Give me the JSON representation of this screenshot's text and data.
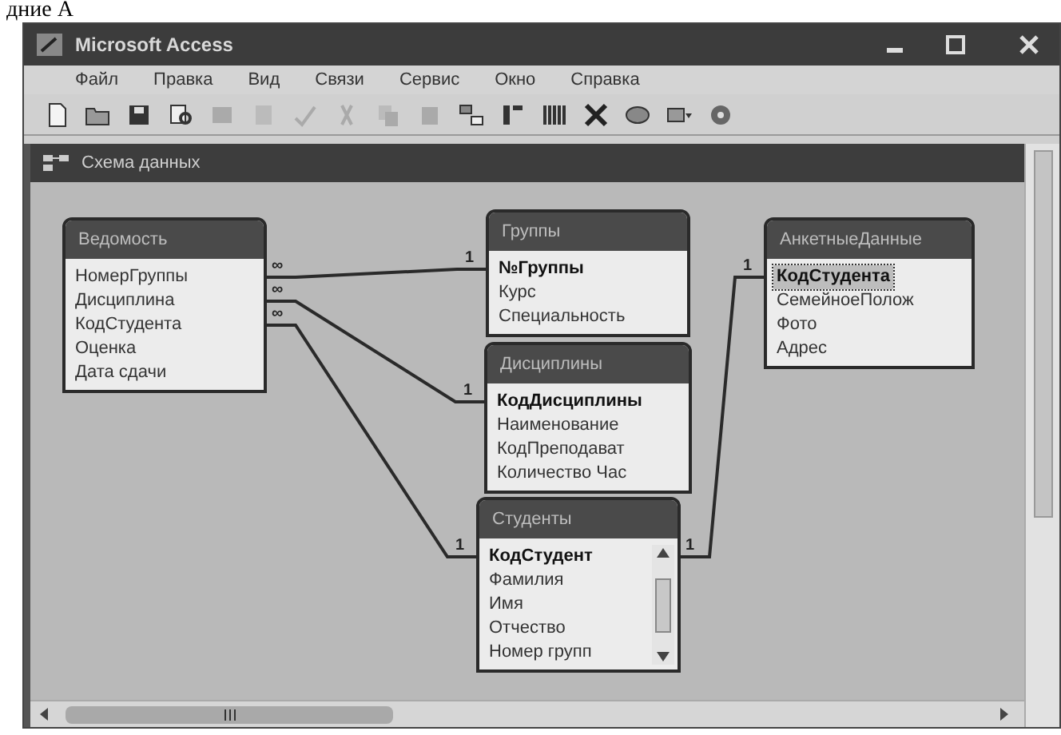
{
  "caption": "дние А",
  "window": {
    "title": "Microsoft Access"
  },
  "menu": [
    "Файл",
    "Правка",
    "Вид",
    "Связи",
    "Сервис",
    "Окно",
    "Справка"
  ],
  "diagram": {
    "title": "Схема данных",
    "tables": [
      {
        "name": "Ведомость",
        "fields": [
          {
            "name": "НомерГруппы",
            "key": false,
            "selected": false
          },
          {
            "name": "Дисциплина",
            "key": false,
            "selected": false
          },
          {
            "name": "КодСтудента",
            "key": false,
            "selected": false
          },
          {
            "name": "Оценка",
            "key": false,
            "selected": false
          },
          {
            "name": "Дата сдачи",
            "key": false,
            "selected": false
          }
        ]
      },
      {
        "name": "Группы",
        "fields": [
          {
            "name": "№Группы",
            "key": true,
            "selected": false
          },
          {
            "name": "Курс",
            "key": false,
            "selected": false
          },
          {
            "name": "Специальность",
            "key": false,
            "selected": false
          }
        ]
      },
      {
        "name": "Дисциплины",
        "fields": [
          {
            "name": "КодДисциплины",
            "key": true,
            "selected": false
          },
          {
            "name": "Наименование",
            "key": false,
            "selected": false
          },
          {
            "name": "КодПреподават",
            "key": false,
            "selected": false
          },
          {
            "name": "Количество Час",
            "key": false,
            "selected": false
          }
        ]
      },
      {
        "name": "АнкетныеДанные",
        "fields": [
          {
            "name": "КодСтудента",
            "key": true,
            "selected": true
          },
          {
            "name": "СемейноеПолож",
            "key": false,
            "selected": false
          },
          {
            "name": "Фото",
            "key": false,
            "selected": false
          },
          {
            "name": "Адрес",
            "key": false,
            "selected": false
          }
        ]
      },
      {
        "name": "Студенты",
        "scrollbar": true,
        "fields": [
          {
            "name": "КодСтудент",
            "key": true,
            "selected": false
          },
          {
            "name": "Фамилия",
            "key": false,
            "selected": false
          },
          {
            "name": "Имя",
            "key": false,
            "selected": false
          },
          {
            "name": "Отчество",
            "key": false,
            "selected": false
          },
          {
            "name": "Номер групп",
            "key": false,
            "selected": false
          }
        ]
      }
    ],
    "relationships": [
      {
        "from_label": "∞",
        "to_label": "1"
      },
      {
        "from_label": "∞",
        "to_label": "1"
      },
      {
        "from_label": "∞",
        "to_label": "1"
      },
      {
        "from_label": "1",
        "to_label": "1"
      }
    ]
  }
}
